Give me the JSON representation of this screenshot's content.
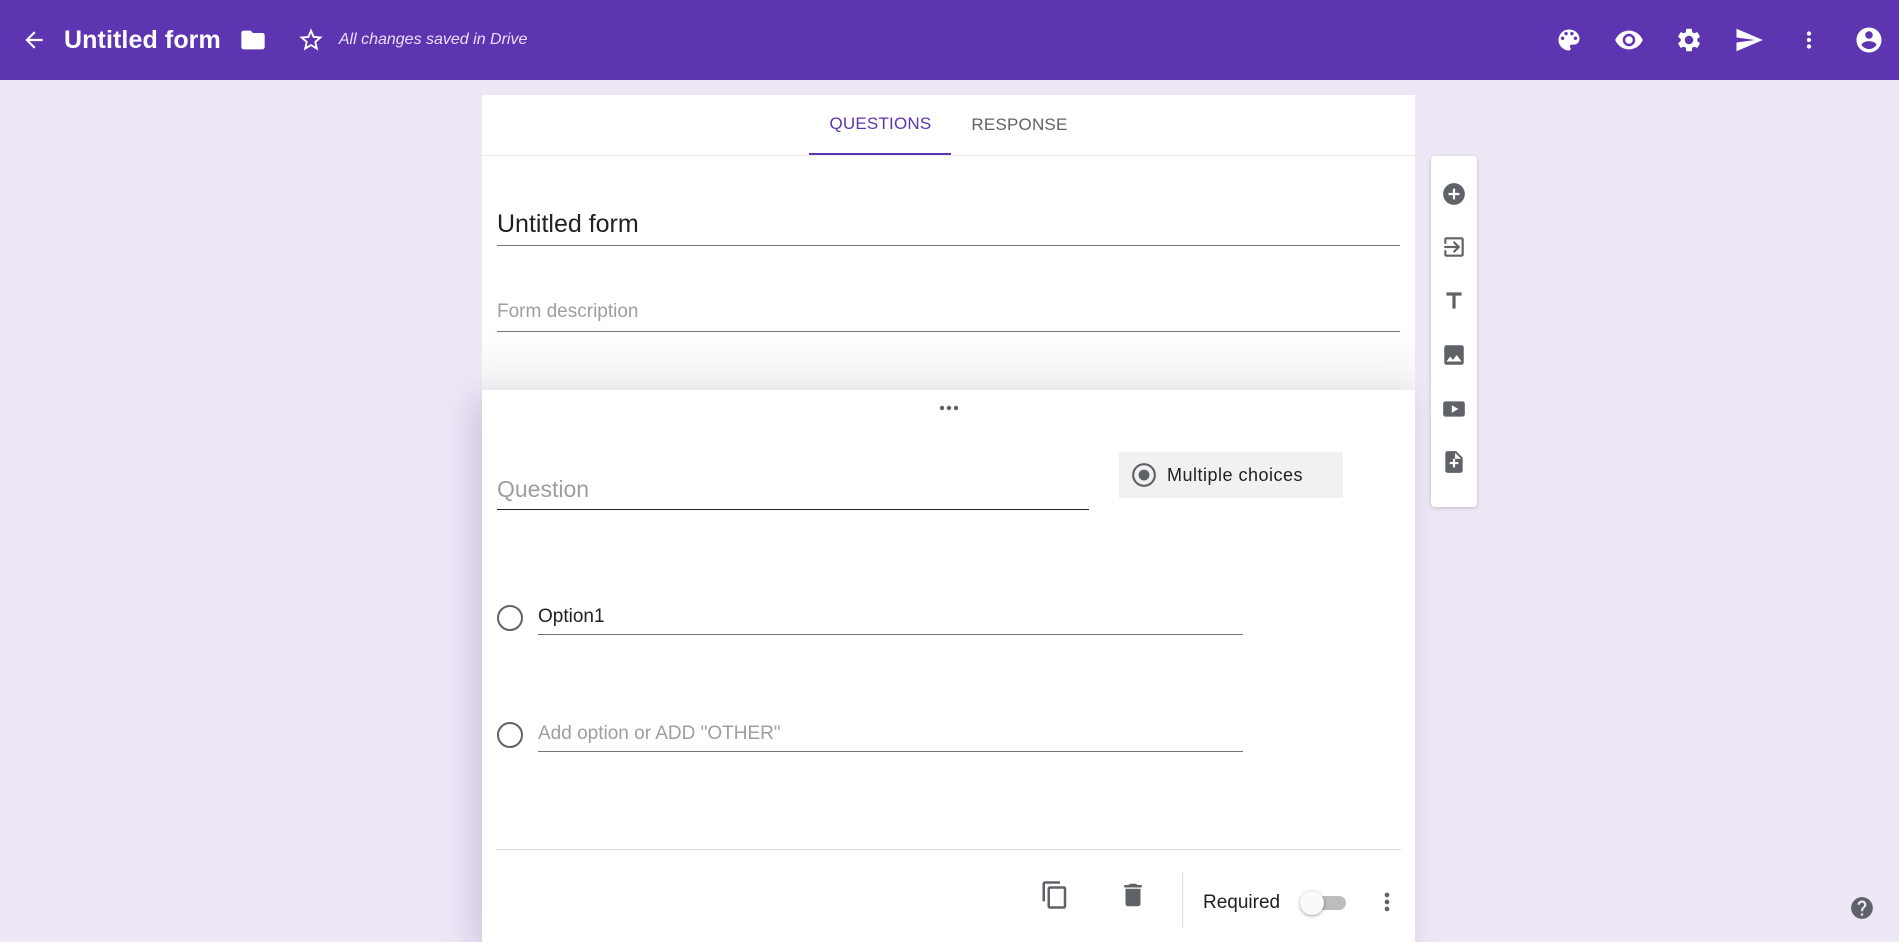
{
  "theme": {
    "accent": "#5e35b1",
    "background": "#ede7f6"
  },
  "appbar": {
    "title": "Untitled form",
    "saved_status": "All changes saved in Drive",
    "icons": [
      "back-arrow-icon",
      "folder-icon",
      "star-icon",
      "palette-icon",
      "eye-icon",
      "gear-icon",
      "send-icon",
      "more-vert-icon",
      "account-icon"
    ]
  },
  "tabs": [
    {
      "label": "QUESTIONS",
      "active": true
    },
    {
      "label": "RESPONSE",
      "active": false
    }
  ],
  "form": {
    "title": "Untitled form",
    "description_placeholder": "Form description"
  },
  "question": {
    "placeholder": "Question",
    "type_label": "Multiple choices",
    "options": [
      {
        "label": "Option1"
      },
      {
        "label": "Add option or ADD \"OTHER\""
      }
    ],
    "required_label": "Required",
    "required": false
  },
  "side_toolbar": {
    "icons": [
      "add-circle-icon",
      "import-question-icon",
      "title-text-icon",
      "image-icon",
      "video-icon",
      "add-section-icon"
    ]
  }
}
